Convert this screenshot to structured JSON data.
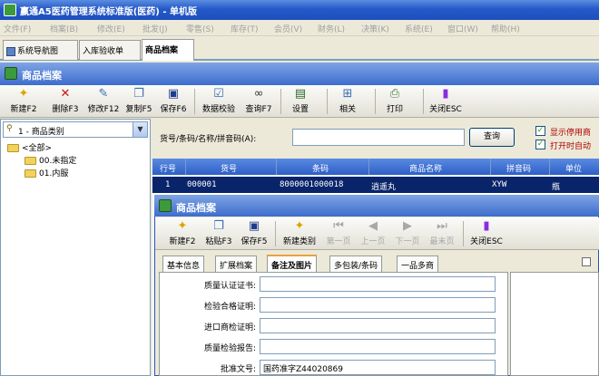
{
  "window": {
    "title": "赢通A5医药管理系统标准版(医药) - 单机版"
  },
  "menu": [
    "文件(F)",
    "档案(B)",
    "修改(E)",
    "批发(J)",
    "零售(S)",
    "库存(T)",
    "会员(V)",
    "财务(L)",
    "决策(K)",
    "系统(E)",
    "窗口(W)",
    "帮助(H)"
  ],
  "tabs": [
    {
      "label": "系统导航图"
    },
    {
      "label": "入库验收单"
    },
    {
      "label": "商品档案"
    }
  ],
  "panel": {
    "title": "商品档案"
  },
  "toolbar": {
    "items": [
      {
        "label": "新建F2",
        "icon": "new-icon"
      },
      {
        "label": "删除F3",
        "icon": "delete-icon"
      },
      {
        "label": "修改F12",
        "icon": "edit-icon"
      },
      {
        "label": "复制F5",
        "icon": "copy-icon"
      },
      {
        "label": "保存F6",
        "icon": "save-icon"
      },
      {
        "label": "数据校验",
        "icon": "validate-icon"
      },
      {
        "label": "查询F7",
        "icon": "binoculars-icon"
      },
      {
        "label": "设置",
        "icon": "settings-icon"
      },
      {
        "label": "相关",
        "icon": "related-icon"
      },
      {
        "label": "打印",
        "icon": "print-icon"
      },
      {
        "label": "关闭ESC",
        "icon": "close-icon"
      }
    ]
  },
  "category": {
    "selected": "1 - 商品类别",
    "tree": [
      "<全部>",
      "00.未指定",
      "01.内服"
    ]
  },
  "search": {
    "label": "货号/条码/名称/拼音码(A):",
    "value": "",
    "button": "查询",
    "check1": "显示停用商",
    "check2": "打开时自动"
  },
  "grid": {
    "columns": [
      "行号",
      "货号",
      "条码",
      "商品名称",
      "拼音码",
      "单位"
    ],
    "rows": [
      [
        "1",
        "000001",
        "8000001000018",
        "逍遥丸",
        "XYW",
        "瓶"
      ]
    ]
  },
  "dialog": {
    "title": "商品档案",
    "toolbar": [
      {
        "label": "新建F2",
        "enabled": true
      },
      {
        "label": "粘贴F3",
        "enabled": true
      },
      {
        "label": "保存F5",
        "enabled": true
      },
      {
        "label": "新建类别",
        "enabled": true
      },
      {
        "label": "第一页",
        "enabled": false
      },
      {
        "label": "上一页",
        "enabled": false
      },
      {
        "label": "下一页",
        "enabled": false
      },
      {
        "label": "最末页",
        "enabled": false
      },
      {
        "label": "关闭ESC",
        "enabled": true
      }
    ],
    "tabs": [
      "基本信息",
      "扩展档案",
      "备注及图片",
      "多包装/条码",
      "一品多商"
    ],
    "fields": [
      {
        "label": "质量认证证书:",
        "value": ""
      },
      {
        "label": "检验合格证明:",
        "value": ""
      },
      {
        "label": "进口商检证明:",
        "value": ""
      },
      {
        "label": "质量检验报告:",
        "value": ""
      },
      {
        "label": "批准文号:",
        "value": "国药准字Z44020869"
      }
    ]
  }
}
